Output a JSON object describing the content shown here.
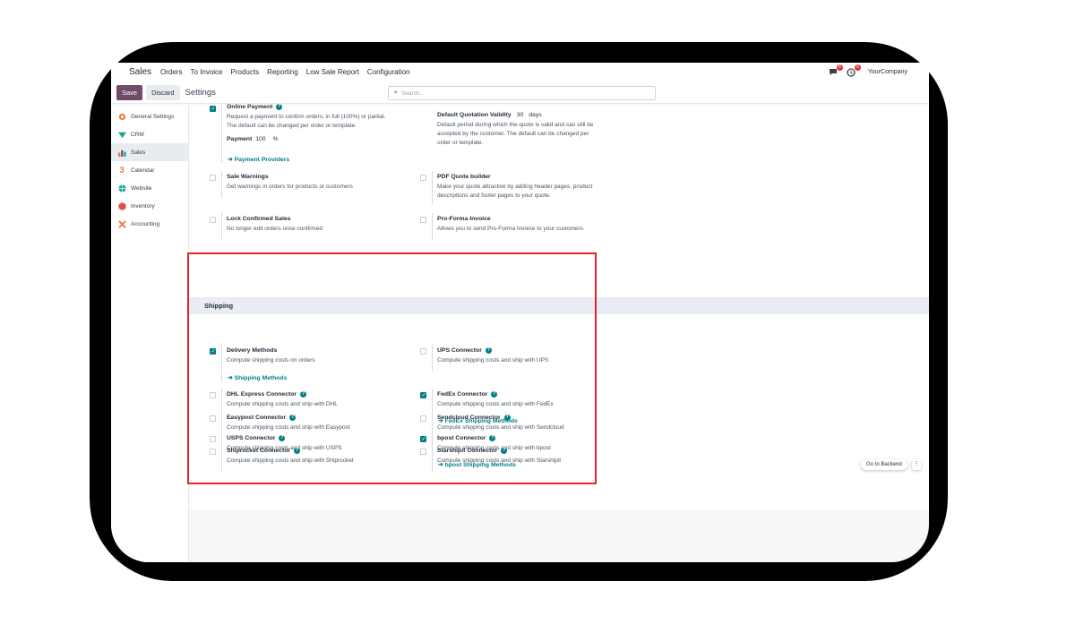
{
  "topbar": {
    "app": "Sales",
    "menus": [
      "Orders",
      "To Invoice",
      "Products",
      "Reporting",
      "Low Sale Report",
      "Configuration"
    ],
    "messages_badge": "8",
    "activity_badge": "6",
    "company": "YourCompany"
  },
  "control": {
    "save": "Save",
    "discard": "Discard",
    "title": "Settings",
    "search_placeholder": "Search..."
  },
  "sidebar": [
    {
      "label": "General Settings",
      "icon": "general-settings-icon"
    },
    {
      "label": "CRM",
      "icon": "crm-icon"
    },
    {
      "label": "Sales",
      "icon": "sales-icon"
    },
    {
      "label": "Calendar",
      "icon": "calendar-icon"
    },
    {
      "label": "Website",
      "icon": "website-icon"
    },
    {
      "label": "Inventory",
      "icon": "inventory-icon"
    },
    {
      "label": "Accounting",
      "icon": "accounting-icon"
    }
  ],
  "quotation": {
    "online_payment": {
      "title": "Online Payment",
      "desc1": "Request a payment to confirm orders, in full (100%) or partial.",
      "desc2": "The default can be changed per order or template.",
      "payment_label": "Payment",
      "payment_value": "100",
      "payment_unit": "%",
      "link": "Payment Providers",
      "checked": true
    },
    "validity": {
      "title": "Default Quotation Validity",
      "value": "30",
      "unit": "days",
      "desc1": "Default period during which the quote is valid and can still be",
      "desc2": "accepted by the customer. The default can be changed per",
      "desc3": "order or template."
    },
    "sale_warnings": {
      "title": "Sale Warnings",
      "desc": "Get warnings in orders for products or customers",
      "checked": false
    },
    "pdf_builder": {
      "title": "PDF Quote builder",
      "desc1": "Make your quote attractive by adding header pages, product",
      "desc2": "descriptions and footer pages to your quote.",
      "checked": false
    },
    "lock_orders": {
      "title": "Lock Confirmed Sales",
      "desc": "No longer edit orders once confirmed",
      "checked": false
    },
    "proforma": {
      "title": "Pro-Forma Invoice",
      "desc": "Allows you to send Pro-Forma Invoice to your customers",
      "checked": false
    }
  },
  "shipping": {
    "heading": "Shipping",
    "delivery": {
      "title": "Delivery Methods",
      "desc": "Compute shipping costs on orders",
      "link": "Shipping Methods",
      "checked": true
    },
    "ups": {
      "title": "UPS Connector",
      "desc": "Compute shipping costs and ship with UPS",
      "checked": false
    },
    "dhl": {
      "title": "DHL Express Connector",
      "desc": "Compute shipping costs and ship with DHL",
      "checked": false
    },
    "fedex": {
      "title": "FedEx Connector",
      "desc": "Compute shipping costs and ship with FedEx",
      "link": "FedEx Shipping Methods",
      "checked": true
    },
    "usps": {
      "title": "USPS Connector",
      "desc": "Compute shipping costs and ship with USPS",
      "checked": false
    },
    "bpost": {
      "title": "bpost Connector",
      "desc": "Compute shipping costs and ship with bpost",
      "link": "bpost Shipping Methods",
      "checked": true
    },
    "easypost": {
      "title": "Easypost Connector",
      "desc": "Compute shipping costs and ship with Easypost",
      "checked": false
    },
    "sendcloud": {
      "title": "Sendcloud Connector",
      "desc": "Compute shipping costs and ship with Sendcloud",
      "checked": false
    },
    "shiprocket": {
      "title": "Shiprocket Connector",
      "desc": "Compute shipping costs and ship with Shiprocket",
      "checked": false
    },
    "starshipit": {
      "title": "Starshipit Connector",
      "desc": "Compute shipping costs and ship with Starshipit",
      "checked": false
    }
  },
  "footer": {
    "go_backend": "Go to Backend"
  },
  "colors": {
    "brand": "#714b67",
    "teal": "#017e84",
    "highlight": "#e3262b"
  }
}
